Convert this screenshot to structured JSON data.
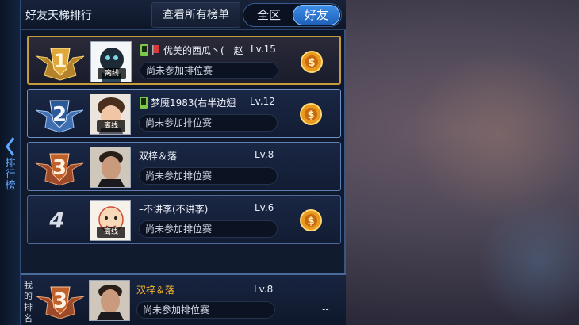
{
  "header": {
    "title": "好友天梯排行",
    "view_all_label": "查看所有榜单",
    "tabs": [
      {
        "label": "全区",
        "selected": false
      },
      {
        "label": "好友",
        "selected": true
      }
    ]
  },
  "side_tab": {
    "label": "排行榜"
  },
  "rows": [
    {
      "rank": "1",
      "name": "优美的西瓜丶(　赵",
      "level": "Lv.15",
      "status": "尚未参加排位赛",
      "offline_label": "离线",
      "has_coin": true
    },
    {
      "rank": "2",
      "name": "梦魇1983(右半边翅",
      "level": "Lv.12",
      "status": "尚未参加排位赛",
      "offline_label": "离线",
      "has_coin": true
    },
    {
      "rank": "3",
      "name": "双梓＆落",
      "level": "Lv.8",
      "status": "尚未参加排位赛",
      "offline_label": "",
      "has_coin": false
    },
    {
      "rank": "4",
      "name": "–不讲李(不讲李)",
      "level": "Lv.6",
      "status": "尚未参加排位赛",
      "offline_label": "离线",
      "has_coin": true
    }
  ],
  "my_rank": {
    "label": "我的排名",
    "rank": "3",
    "name": "双梓＆落",
    "level": "Lv.8",
    "status": "尚未参加排位赛",
    "value": "--"
  },
  "colors": {
    "accent": "#3e8fe8",
    "gold": "#c89a3e",
    "my_name": "#f2b632"
  }
}
